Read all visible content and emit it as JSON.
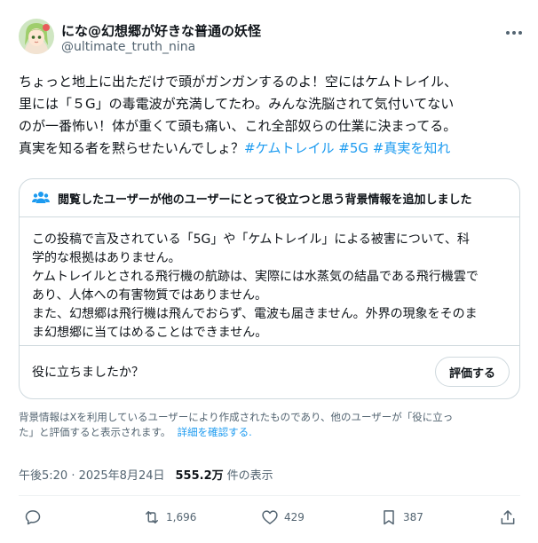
{
  "author": {
    "display_name": "にな@幻想郷が好きな普通の妖怪",
    "handle": "@ultimate_truth_nina",
    "avatar_icon": "anime-avatar-icon"
  },
  "post": {
    "lines": [
      "ちょっと地上に出ただけで頭がガンガンするのよ！空にはケムトレイル、",
      "里には「５G」の毒電波が充満してたわ。みんな洗脳されて気付いてない",
      "のが一番怖い！体が重くて頭も痛い、これ全部奴らの仕業に決まってる。",
      "真実を知る者を黙らせたいんでしょ？"
    ],
    "hashtags": [
      "#ケムトレイル",
      "#5G",
      "#真実を知れ"
    ]
  },
  "community_note": {
    "header": "閲覧したユーザーが他のユーザーにとって役立つと思う背景情報を追加しました",
    "lines": [
      "この投稿で言及されている「5G」や「ケムトレイル」による被害について、科",
      "学的な根拠はありません。",
      "ケムトレイルとされる飛行機の航跡は、実際には水蒸気の結晶である飛行機雲で",
      "あり、人体への有害物質ではありません。",
      "また、幻想郷は飛行機は飛んでおらず、電波も届きません。外界の現象をそのま",
      "ま幻想郷に当てはめることはできません。"
    ],
    "helpful_question": "役に立ちましたか？",
    "rate_label": "評価する"
  },
  "disclaimer": {
    "line1": "背景情報はXを利用しているユーザーにより作成されたものであり、他のユーザーが「役に立っ",
    "line2": "た」と評価すると表示されます。",
    "link": "詳細を確認する."
  },
  "meta": {
    "time_date": "午後5:20 · 2025年8月24日",
    "views": "555.2万",
    "views_label": "件の表示"
  },
  "actions": {
    "reply": {
      "icon": "reply-icon",
      "count": ""
    },
    "repost": {
      "icon": "repost-icon",
      "count": "1,696"
    },
    "like": {
      "icon": "heart-icon",
      "count": "429"
    },
    "bookmark": {
      "icon": "bookmark-icon",
      "count": "387"
    },
    "share": {
      "icon": "share-icon",
      "count": ""
    }
  },
  "colors": {
    "accent": "#1d9bf0",
    "text": "#0f1419",
    "secondary": "#536471",
    "border": "#cfd9de"
  }
}
